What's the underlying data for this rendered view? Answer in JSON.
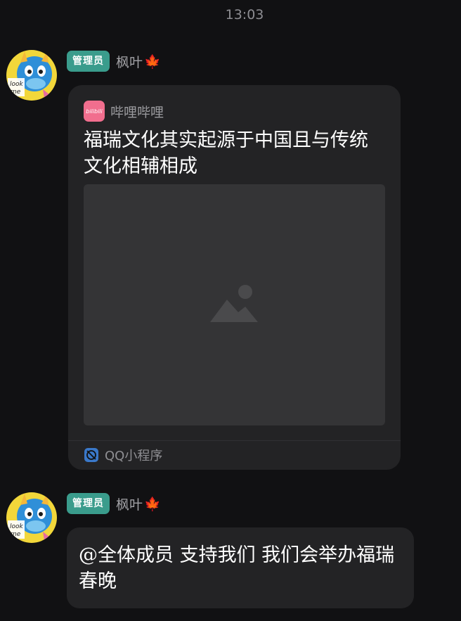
{
  "chat": {
    "timestamp": "13:03"
  },
  "messages": [
    {
      "sender": {
        "role_badge": "管理员",
        "name": "枫叶",
        "name_emoji": "🍁",
        "avatar_icon": "blue-dragon-avatar",
        "avatar_text": "look me"
      },
      "type": "mini-program-card",
      "card": {
        "source_name": "哔哩哔哩",
        "source_icon": "bilibili-logo",
        "source_logo_text": "bilibili",
        "title": "福瑞文化其实起源于中国且与传统文化相辅相成",
        "image_placeholder_icon": "image-placeholder-icon",
        "footer_icon": "qq-mini-program-icon",
        "footer_label": "QQ小程序"
      }
    },
    {
      "sender": {
        "role_badge": "管理员",
        "name": "枫叶",
        "name_emoji": "🍁",
        "avatar_icon": "blue-dragon-avatar",
        "avatar_text": "look me"
      },
      "type": "text",
      "text": "@全体成员 支持我们 我们会举办福瑞春晚"
    }
  ],
  "colors": {
    "background": "#111113",
    "bubble": "#232325",
    "badge": "#3a9c8c",
    "bilibili_pink": "#f16e8e"
  }
}
